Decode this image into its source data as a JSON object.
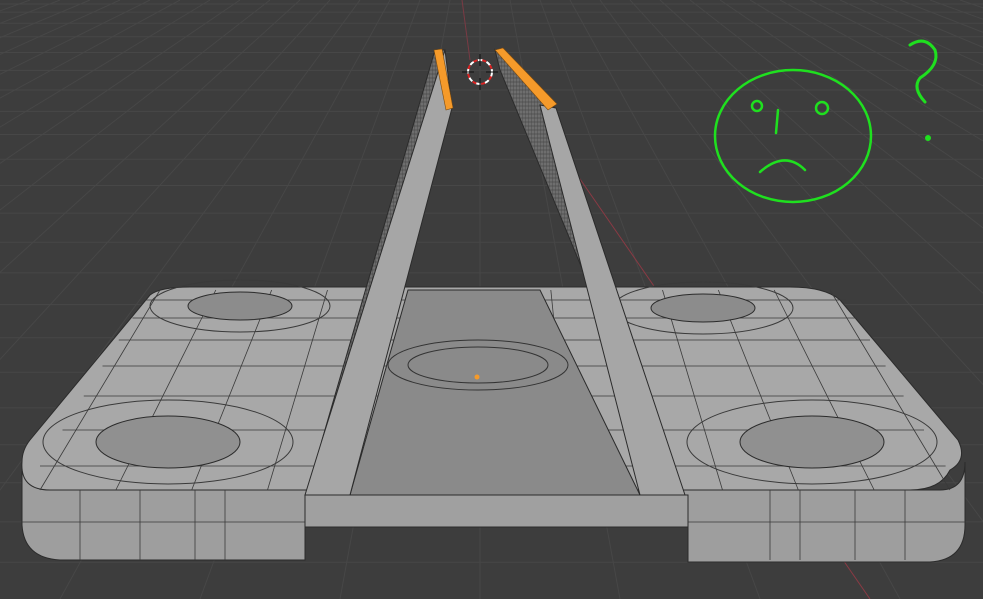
{
  "viewport": {
    "mode": "edit-mode-3d-viewport",
    "background_color": "#3d3d3d",
    "grid_color": "#474747",
    "x_axis_color": "#8a3a44",
    "mesh_face_color": "#a3a3a3",
    "mesh_edge_color": "#2b2b2b",
    "selection_color": "#f59a2a",
    "annotation_color": "#1fe01f"
  },
  "icons": [
    "3d-cursor-icon",
    "origin-point-icon",
    "sad-face-annotation-icon",
    "question-mark-annotation-icon"
  ]
}
